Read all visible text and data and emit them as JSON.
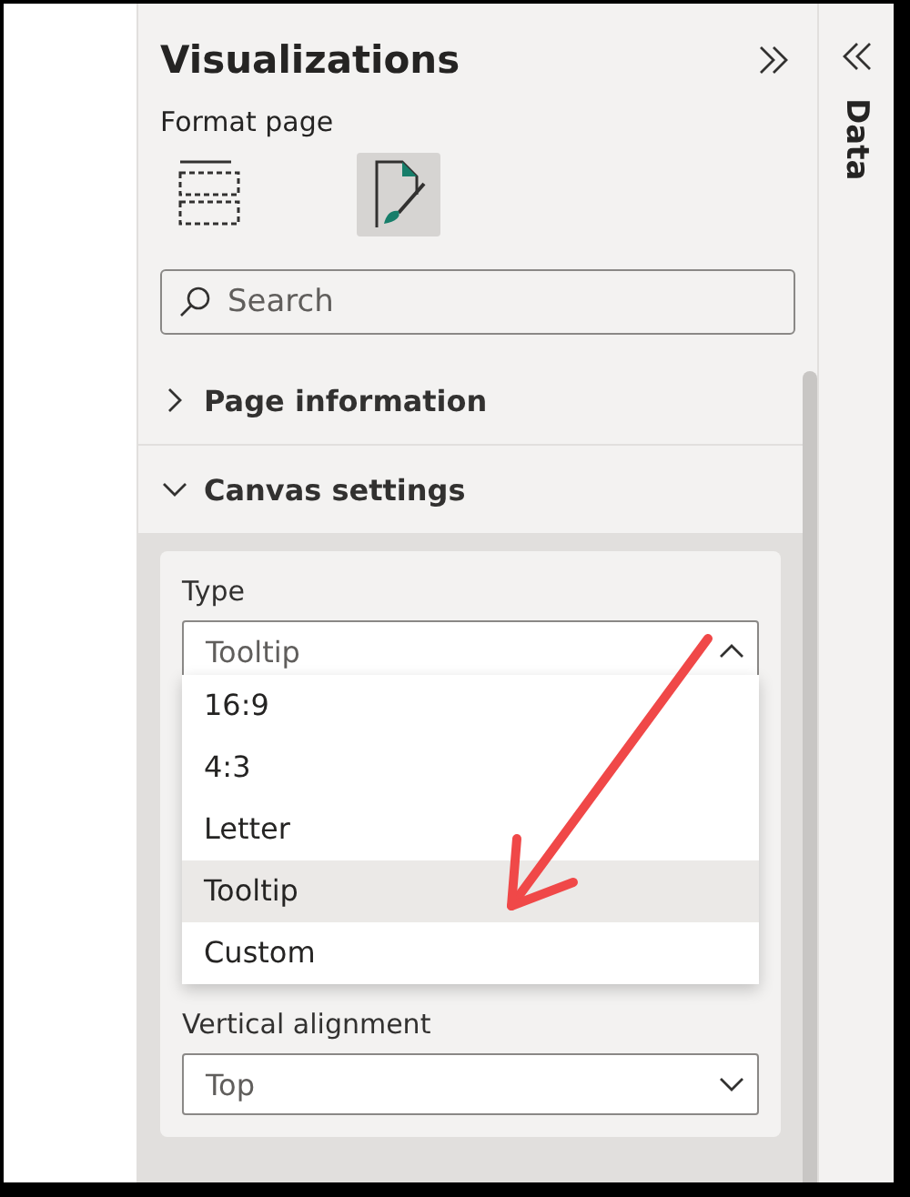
{
  "visualizations": {
    "title": "Visualizations",
    "subtitle": "Format page"
  },
  "format_tabs": [
    {
      "kind": "build",
      "selected": false
    },
    {
      "kind": "format",
      "selected": true
    }
  ],
  "search": {
    "placeholder": "Search"
  },
  "sections": [
    {
      "label": "Page information",
      "expanded": false
    },
    {
      "label": "Canvas settings",
      "expanded": true
    }
  ],
  "type_field": {
    "label": "Type",
    "value": "Tooltip",
    "expanded": true
  },
  "type_options": [
    {
      "label": "16:9",
      "selected": false
    },
    {
      "label": "4:3",
      "selected": false
    },
    {
      "label": "Letter",
      "selected": false
    },
    {
      "label": "Tooltip",
      "selected": true
    },
    {
      "label": "Custom",
      "selected": false
    }
  ],
  "vertical_alignment": {
    "label": "Vertical alignment",
    "value": "Top",
    "expanded": false
  },
  "data_pane": {
    "title": "Data"
  }
}
